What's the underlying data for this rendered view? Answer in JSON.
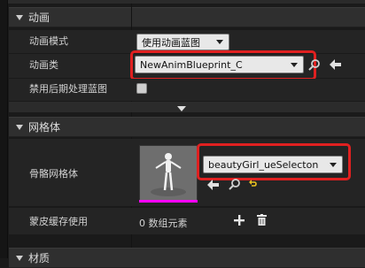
{
  "sections": {
    "animation": {
      "title": "动画"
    },
    "mesh": {
      "title": "网格体"
    },
    "material": {
      "title": "材质"
    }
  },
  "animation": {
    "mode_label": "动画模式",
    "mode_value": "使用动画蓝图",
    "class_label": "动画类",
    "class_value": "NewAnimBlueprint_C",
    "postprocess_label": "禁用后期处理蓝图"
  },
  "mesh": {
    "skeletal_label": "骨骼网格体",
    "skeletal_value": "beautyGirl_ueSelecton",
    "skin_cache_label": "蒙皮缓存使用",
    "skin_cache_value": "0 数组元素"
  },
  "colors": {
    "highlight": "#e02020",
    "thumbnail_bar": "#ff00ff"
  }
}
